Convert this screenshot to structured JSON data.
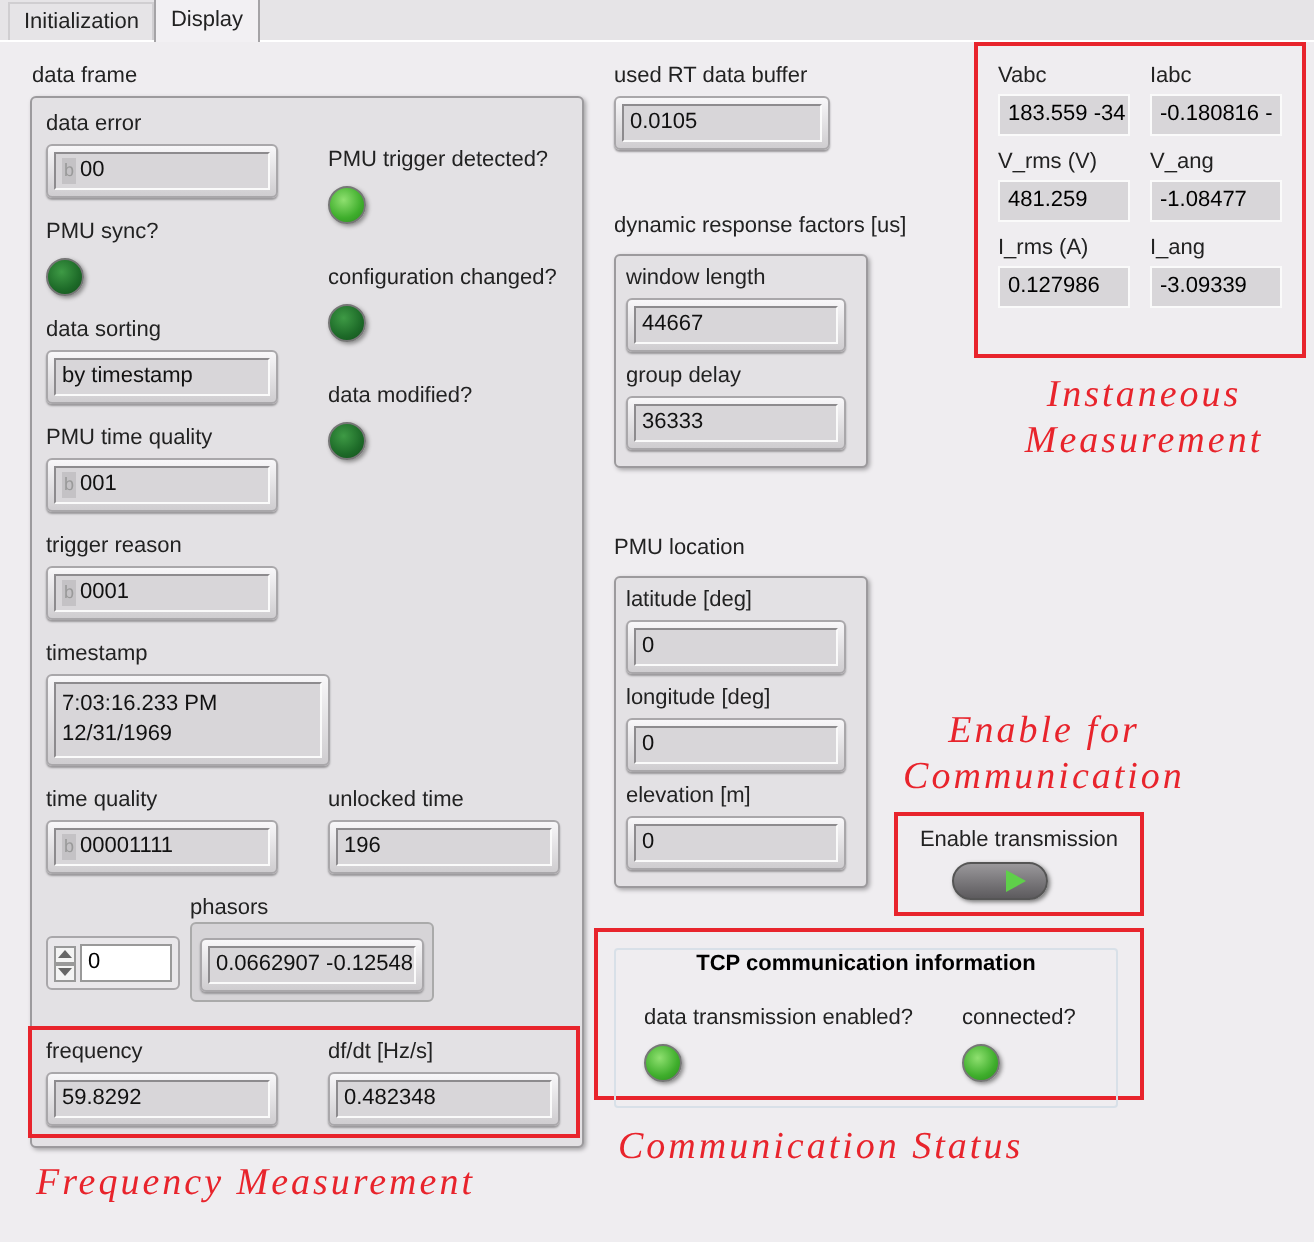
{
  "tabs": [
    {
      "label": "Initialization",
      "selected": false
    },
    {
      "label": "Display",
      "selected": true
    }
  ],
  "data_frame": {
    "label": "data frame",
    "data_error": {
      "label": "data error",
      "radix": "b",
      "value": "00"
    },
    "pmu_trigger_detected": {
      "label": "PMU trigger detected?",
      "on": true
    },
    "pmu_sync": {
      "label": "PMU sync?",
      "on": false
    },
    "configuration_changed": {
      "label": "configuration changed?",
      "on": false
    },
    "data_sorting": {
      "label": "data sorting",
      "value": "by timestamp"
    },
    "data_modified": {
      "label": "data modified?",
      "on": false
    },
    "pmu_time_quality": {
      "label": "PMU time quality",
      "radix": "b",
      "value": "001"
    },
    "trigger_reason": {
      "label": "trigger reason",
      "radix": "b",
      "value": "0001"
    },
    "timestamp": {
      "label": "timestamp",
      "value": "7:03:16.233 PM\n12/31/1969"
    },
    "time_quality": {
      "label": "time quality",
      "radix": "b",
      "value": "00001111"
    },
    "unlocked_time": {
      "label": "unlocked time",
      "value": "196"
    },
    "phasors": {
      "label": "phasors",
      "index": "0",
      "value": "0.0662907 -0.12548"
    },
    "frequency": {
      "label": "frequency",
      "value": "59.8292"
    },
    "dfdt": {
      "label": "df/dt [Hz/s]",
      "value": "0.482348"
    }
  },
  "frequency_annotation": "Frequency Measurement",
  "used_rt_data_buffer": {
    "label": "used RT data buffer",
    "value": "0.0105"
  },
  "dynamic_response_factors": {
    "label": "dynamic response factors [us]",
    "fields": [
      {
        "label": "window length",
        "value": "44667"
      },
      {
        "label": "group delay",
        "value": "36333"
      }
    ]
  },
  "pmu_location": {
    "label": "PMU location",
    "fields": [
      {
        "label": "latitude [deg]",
        "value": "0"
      },
      {
        "label": "longitude [deg]",
        "value": "0"
      },
      {
        "label": "elevation [m]",
        "value": "0"
      }
    ]
  },
  "instantaneous": {
    "fields": [
      {
        "label": "Vabc",
        "value": "183.559 -34"
      },
      {
        "label": "Iabc",
        "value": "-0.180816 -"
      },
      {
        "label": "V_rms (V)",
        "value": "481.259"
      },
      {
        "label": "V_ang",
        "value": "-1.08477"
      },
      {
        "label": "I_rms (A)",
        "value": "0.127986"
      },
      {
        "label": "I_ang",
        "value": "-3.09339"
      }
    ],
    "annotation": "Instaneous Measurement"
  },
  "enable_annotation": "Enable for Communication",
  "enable_transmission": {
    "label": "Enable transmission",
    "on": true
  },
  "tcp": {
    "title": "TCP communication information",
    "leds": [
      {
        "label": "data transmission enabled?",
        "on": true
      },
      {
        "label": "connected?",
        "on": true
      }
    ]
  },
  "communication_annotation": "Communication Status"
}
